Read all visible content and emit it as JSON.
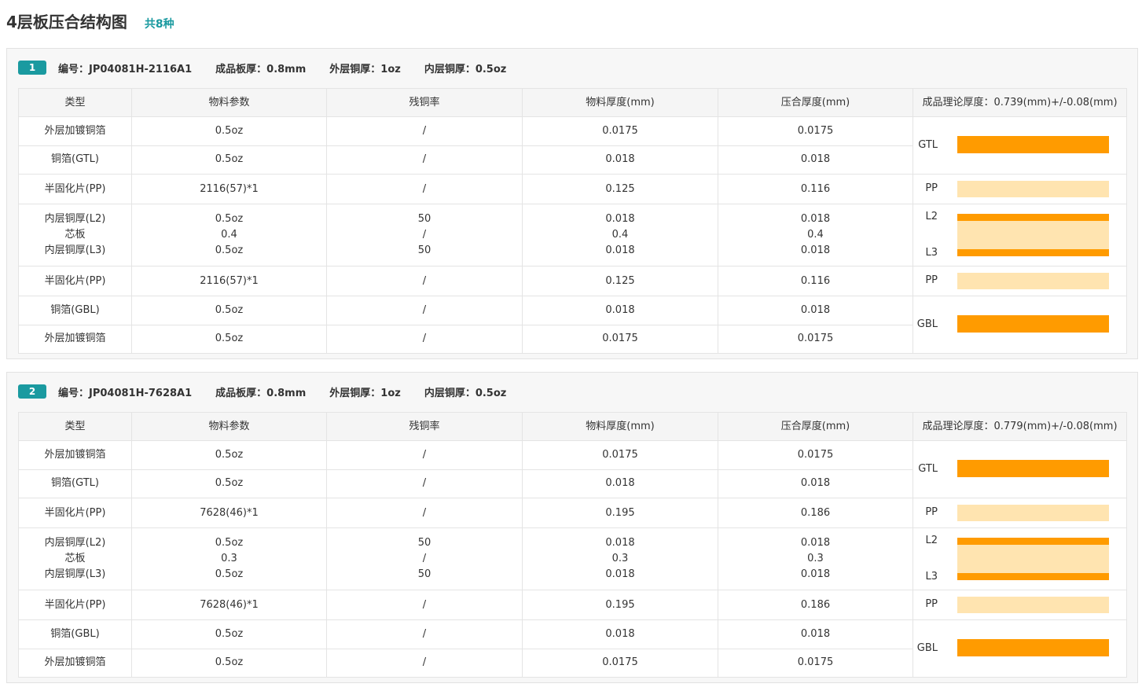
{
  "page": {
    "title": "4层板压合结构图",
    "count": "共8种"
  },
  "colors": {
    "accent": "#1a9aa0",
    "copper": "#ff9b00",
    "prepreg": "#ffe4b0"
  },
  "stack_labels": {
    "top": "GTL",
    "pp": "PP",
    "l2": "L2",
    "l3": "L3",
    "bottom": "GBL"
  },
  "cards": [
    {
      "index": "1",
      "number": "编号：JP04081H-2116A1",
      "board_thickness": "成品板厚：0.8mm",
      "outer_copper": "外层铜厚：1oz",
      "inner_copper": "内层铜厚：0.5oz",
      "headers": [
        "类型",
        "物料参数",
        "残铜率",
        "物料厚度(mm)",
        "压合厚度(mm)",
        "成品理论厚度：0.739(mm)+/-0.08(mm)"
      ],
      "rows": [
        {
          "type": "外层加镀铜箔",
          "param": "0.5oz",
          "residual": "/",
          "material": "0.0175",
          "pressed": "0.0175"
        },
        {
          "type": "铜箔(GTL)",
          "param": "0.5oz",
          "residual": "/",
          "material": "0.018",
          "pressed": "0.018"
        },
        {
          "type": "半固化片(PP)",
          "param": "2116(57)*1",
          "residual": "/",
          "material": "0.125",
          "pressed": "0.116"
        },
        {
          "type": "内层铜厚(L2)",
          "param": "0.5oz",
          "residual": "50",
          "material": "0.018",
          "pressed": "0.018"
        },
        {
          "type": "芯板",
          "param": "0.4",
          "residual": "/",
          "material": "0.4",
          "pressed": "0.4"
        },
        {
          "type": "内层铜厚(L3)",
          "param": "0.5oz",
          "residual": "50",
          "material": "0.018",
          "pressed": "0.018"
        },
        {
          "type": "半固化片(PP)",
          "param": "2116(57)*1",
          "residual": "/",
          "material": "0.125",
          "pressed": "0.116"
        },
        {
          "type": "铜箔(GBL)",
          "param": "0.5oz",
          "residual": "/",
          "material": "0.018",
          "pressed": "0.018"
        },
        {
          "type": "外层加镀铜箔",
          "param": "0.5oz",
          "residual": "/",
          "material": "0.0175",
          "pressed": "0.0175"
        }
      ]
    },
    {
      "index": "2",
      "number": "编号：JP04081H-7628A1",
      "board_thickness": "成品板厚：0.8mm",
      "outer_copper": "外层铜厚：1oz",
      "inner_copper": "内层铜厚：0.5oz",
      "headers": [
        "类型",
        "物料参数",
        "残铜率",
        "物料厚度(mm)",
        "压合厚度(mm)",
        "成品理论厚度：0.779(mm)+/-0.08(mm)"
      ],
      "rows": [
        {
          "type": "外层加镀铜箔",
          "param": "0.5oz",
          "residual": "/",
          "material": "0.0175",
          "pressed": "0.0175"
        },
        {
          "type": "铜箔(GTL)",
          "param": "0.5oz",
          "residual": "/",
          "material": "0.018",
          "pressed": "0.018"
        },
        {
          "type": "半固化片(PP)",
          "param": "7628(46)*1",
          "residual": "/",
          "material": "0.195",
          "pressed": "0.186"
        },
        {
          "type": "内层铜厚(L2)",
          "param": "0.5oz",
          "residual": "50",
          "material": "0.018",
          "pressed": "0.018"
        },
        {
          "type": "芯板",
          "param": "0.3",
          "residual": "/",
          "material": "0.3",
          "pressed": "0.3"
        },
        {
          "type": "内层铜厚(L3)",
          "param": "0.5oz",
          "residual": "50",
          "material": "0.018",
          "pressed": "0.018"
        },
        {
          "type": "半固化片(PP)",
          "param": "7628(46)*1",
          "residual": "/",
          "material": "0.195",
          "pressed": "0.186"
        },
        {
          "type": "铜箔(GBL)",
          "param": "0.5oz",
          "residual": "/",
          "material": "0.018",
          "pressed": "0.018"
        },
        {
          "type": "外层加镀铜箔",
          "param": "0.5oz",
          "residual": "/",
          "material": "0.0175",
          "pressed": "0.0175"
        }
      ]
    }
  ]
}
